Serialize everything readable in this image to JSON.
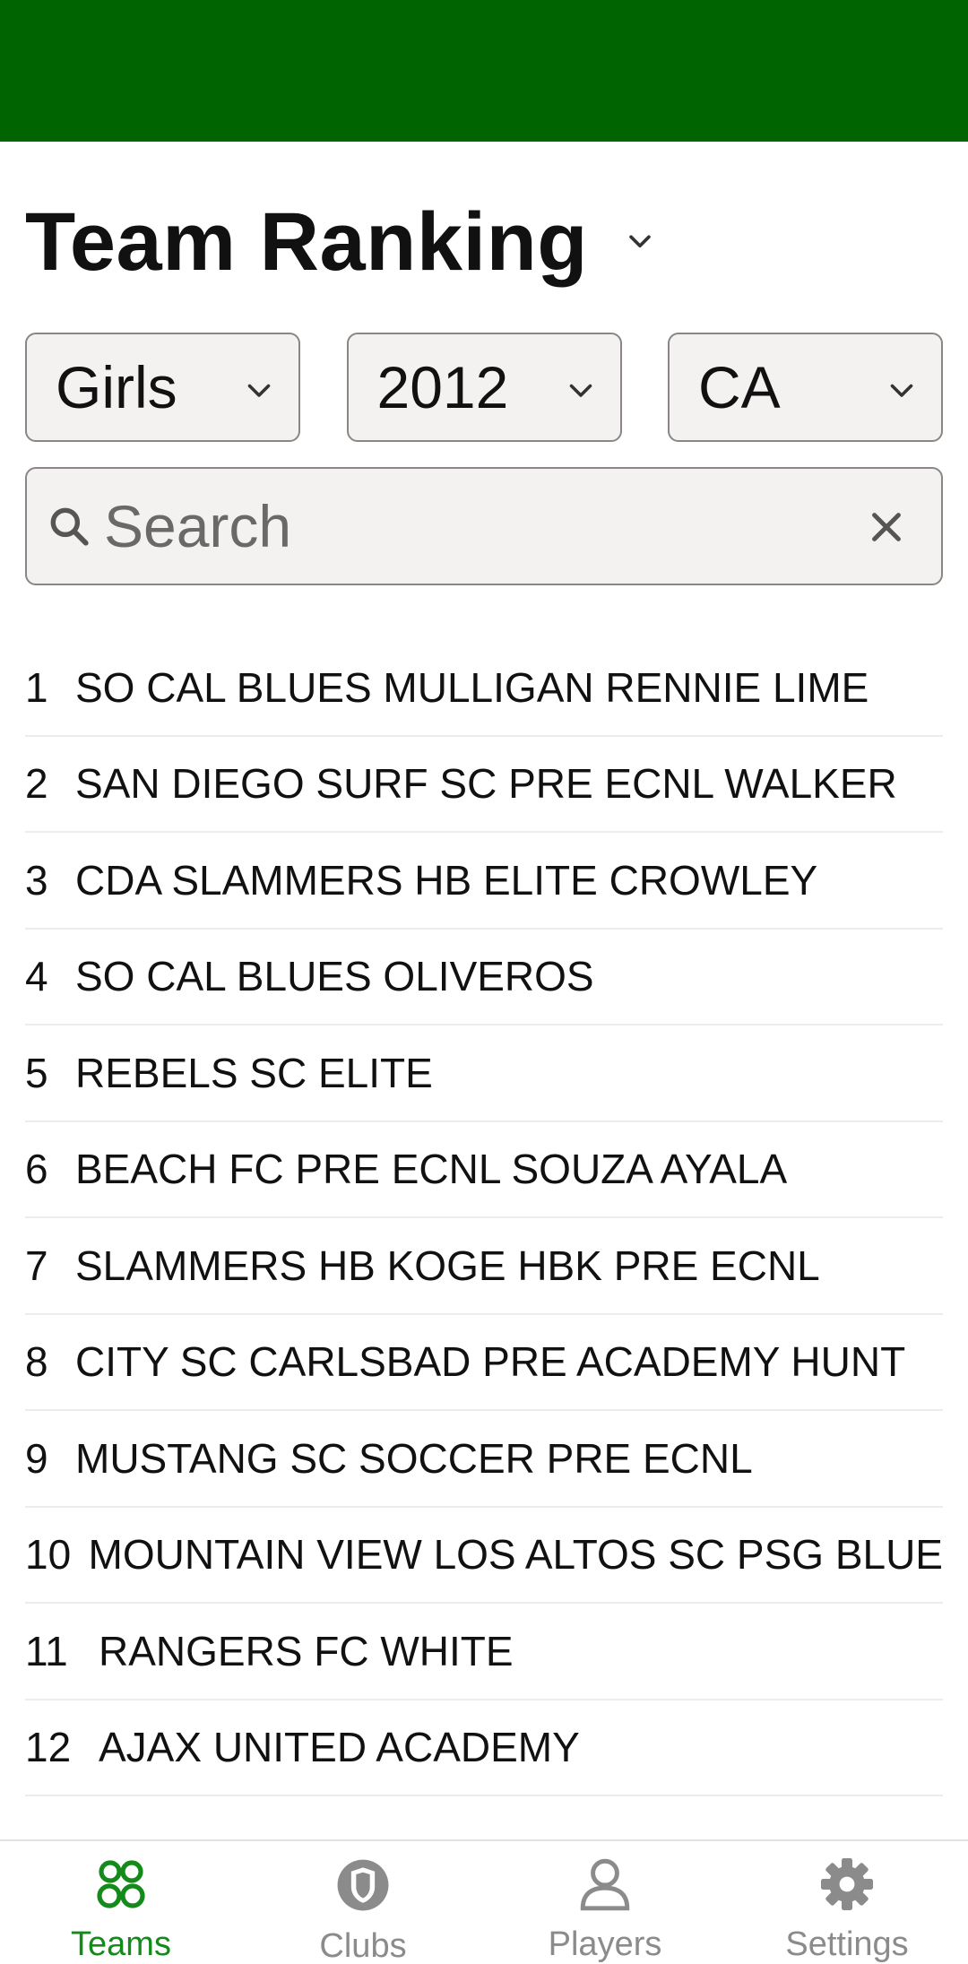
{
  "colors": {
    "header": "#006400",
    "active_tab": "#138a1a",
    "inactive_tab": "#8b8b8b"
  },
  "header": {
    "title": "Team Ranking"
  },
  "filters": {
    "gender": "Girls",
    "year": "2012",
    "state": "CA"
  },
  "search": {
    "placeholder": "Search",
    "value": ""
  },
  "rankings": [
    {
      "rank": "1",
      "team": "SO CAL BLUES MULLIGAN RENNIE LIME"
    },
    {
      "rank": "2",
      "team": "SAN DIEGO SURF SC PRE ECNL WALKER"
    },
    {
      "rank": "3",
      "team": "CDA SLAMMERS HB ELITE CROWLEY"
    },
    {
      "rank": "4",
      "team": "SO CAL BLUES OLIVEROS"
    },
    {
      "rank": "5",
      "team": "REBELS SC ELITE"
    },
    {
      "rank": "6",
      "team": "BEACH FC PRE ECNL SOUZA AYALA"
    },
    {
      "rank": "7",
      "team": "SLAMMERS HB KOGE HBK PRE ECNL"
    },
    {
      "rank": "8",
      "team": "CITY SC CARLSBAD PRE ACADEMY HUNT"
    },
    {
      "rank": "9",
      "team": "MUSTANG SC SOCCER PRE ECNL"
    },
    {
      "rank": "10",
      "team": "MOUNTAIN VIEW LOS ALTOS SC PSG BLUE"
    },
    {
      "rank": "11",
      "team": "RANGERS FC WHITE"
    },
    {
      "rank": "12",
      "team": "AJAX UNITED ACADEMY"
    }
  ],
  "nav": {
    "tabs": [
      {
        "label": "Teams",
        "icon": "teams-icon",
        "active": true
      },
      {
        "label": "Clubs",
        "icon": "shield-icon",
        "active": false
      },
      {
        "label": "Players",
        "icon": "person-icon",
        "active": false
      },
      {
        "label": "Settings",
        "icon": "gear-icon",
        "active": false
      }
    ]
  }
}
